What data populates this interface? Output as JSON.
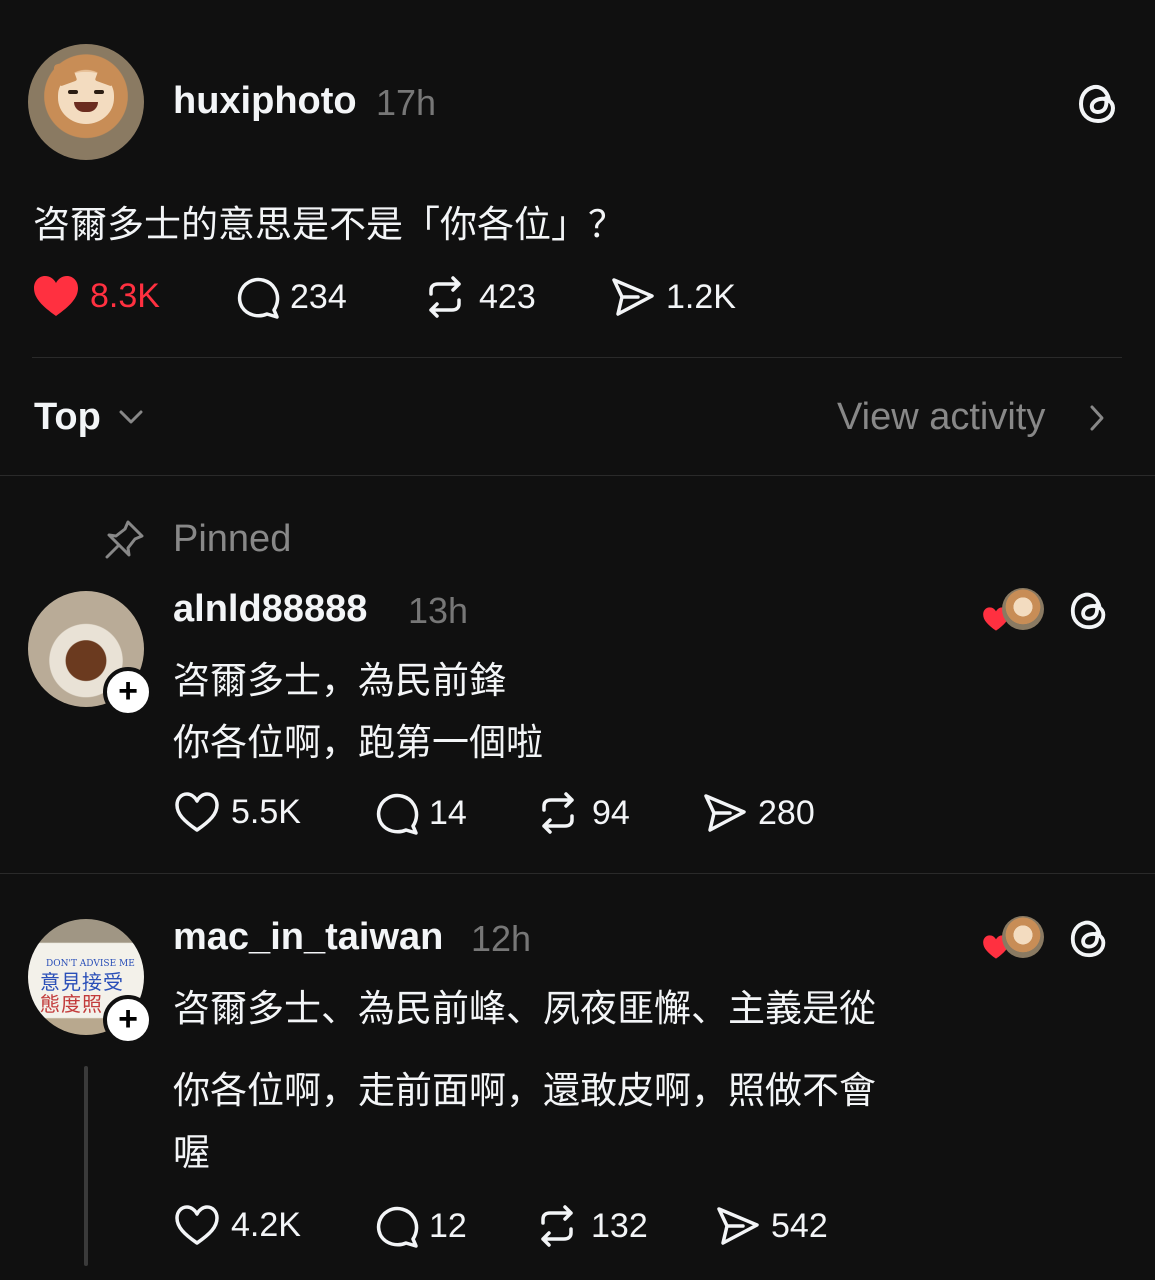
{
  "post": {
    "username": "huxiphoto",
    "time": "17h",
    "text": "咨爾多士的意思是不是「你各位」？",
    "likes": "8.3K",
    "replies": "234",
    "reposts": "423",
    "shares": "1.2K",
    "liked": true
  },
  "sort": {
    "label": "Top",
    "view_activity": "View activity"
  },
  "pinned_label": "Pinned",
  "replies": [
    {
      "username": "alnld88888",
      "time": "13h",
      "lines": [
        "咨爾多士，為民前鋒",
        "你各位啊，跑第一個啦"
      ],
      "likes": "5.5K",
      "replies": "14",
      "reposts": "94",
      "shares": "280"
    },
    {
      "username": "mac_in_taiwan",
      "time": "12h",
      "lines": [
        "咨爾多士、為民前峰、夙夜匪懈、主義是從",
        "你各位啊，走前面啊，還敢皮啊，照做不會",
        "喔"
      ],
      "likes": "4.2K",
      "replies": "12",
      "reposts": "132",
      "shares": "542"
    }
  ],
  "avatar_sign": {
    "top_text": "DON'T ADVISE ME",
    "line1": "意見接受",
    "line2": "態度照"
  },
  "colors": {
    "background": "#101010",
    "like_red": "#ff3040",
    "muted": "#777777"
  }
}
